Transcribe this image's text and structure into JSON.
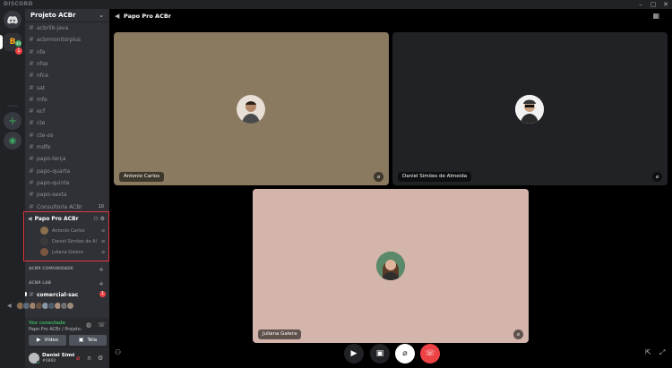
{
  "app": {
    "brand": "DISCORD",
    "window_controls": [
      "–",
      "▢",
      "✕"
    ]
  },
  "servers": {
    "acbr_label": "B",
    "badge_count": "1",
    "badge_small": "44"
  },
  "guild": {
    "name": "Projeto ACBr"
  },
  "channels": [
    "acbrlib-java",
    "acbrmonitorplus",
    "nfe",
    "nfse",
    "nfce",
    "sat",
    "mfe",
    "ecf",
    "cte",
    "cte-os",
    "mdfe",
    "papo-terça",
    "papo-quarta",
    "papo-quinta",
    "papo-sexta",
    "Consultoria ACBr"
  ],
  "consultoria_count": "10",
  "voice_channel": {
    "name": "Papo Pro ACBr",
    "users": [
      {
        "name": "Antonio Carlos",
        "avatar_color": "#8b6f4e"
      },
      {
        "name": "Daniel Simões de Al...",
        "avatar_color": "#3a3a3a"
      },
      {
        "name": "Juliana Galera",
        "avatar_color": "#7a5540"
      }
    ]
  },
  "categories": {
    "community": "ACBR COMUNIDADE",
    "lab": "ACBR LAB"
  },
  "lab_channel": {
    "name": "comercial-sac",
    "mention_count": "1"
  },
  "voice_panel": {
    "status": "Voz conectada",
    "channel": "Papo Pro ACBr / Projeto AC...",
    "video_label": "Vídeo",
    "screen_label": "Tela"
  },
  "user": {
    "name": "Daniel Simõ...",
    "tag": "#0860"
  },
  "main": {
    "title": "Papo Pro ACBr"
  },
  "tiles": [
    {
      "name": "Antonio Carlos",
      "bg": "#8a7a60"
    },
    {
      "name": "Daniel Simões de Almeida",
      "bg": "#202225"
    },
    {
      "name": "Juliana Galera",
      "bg": "#d4b5ac"
    }
  ],
  "colors": {
    "accent_green": "#3ba55d",
    "danger_red": "#ed4245",
    "highlight_border": "#e0383e"
  }
}
